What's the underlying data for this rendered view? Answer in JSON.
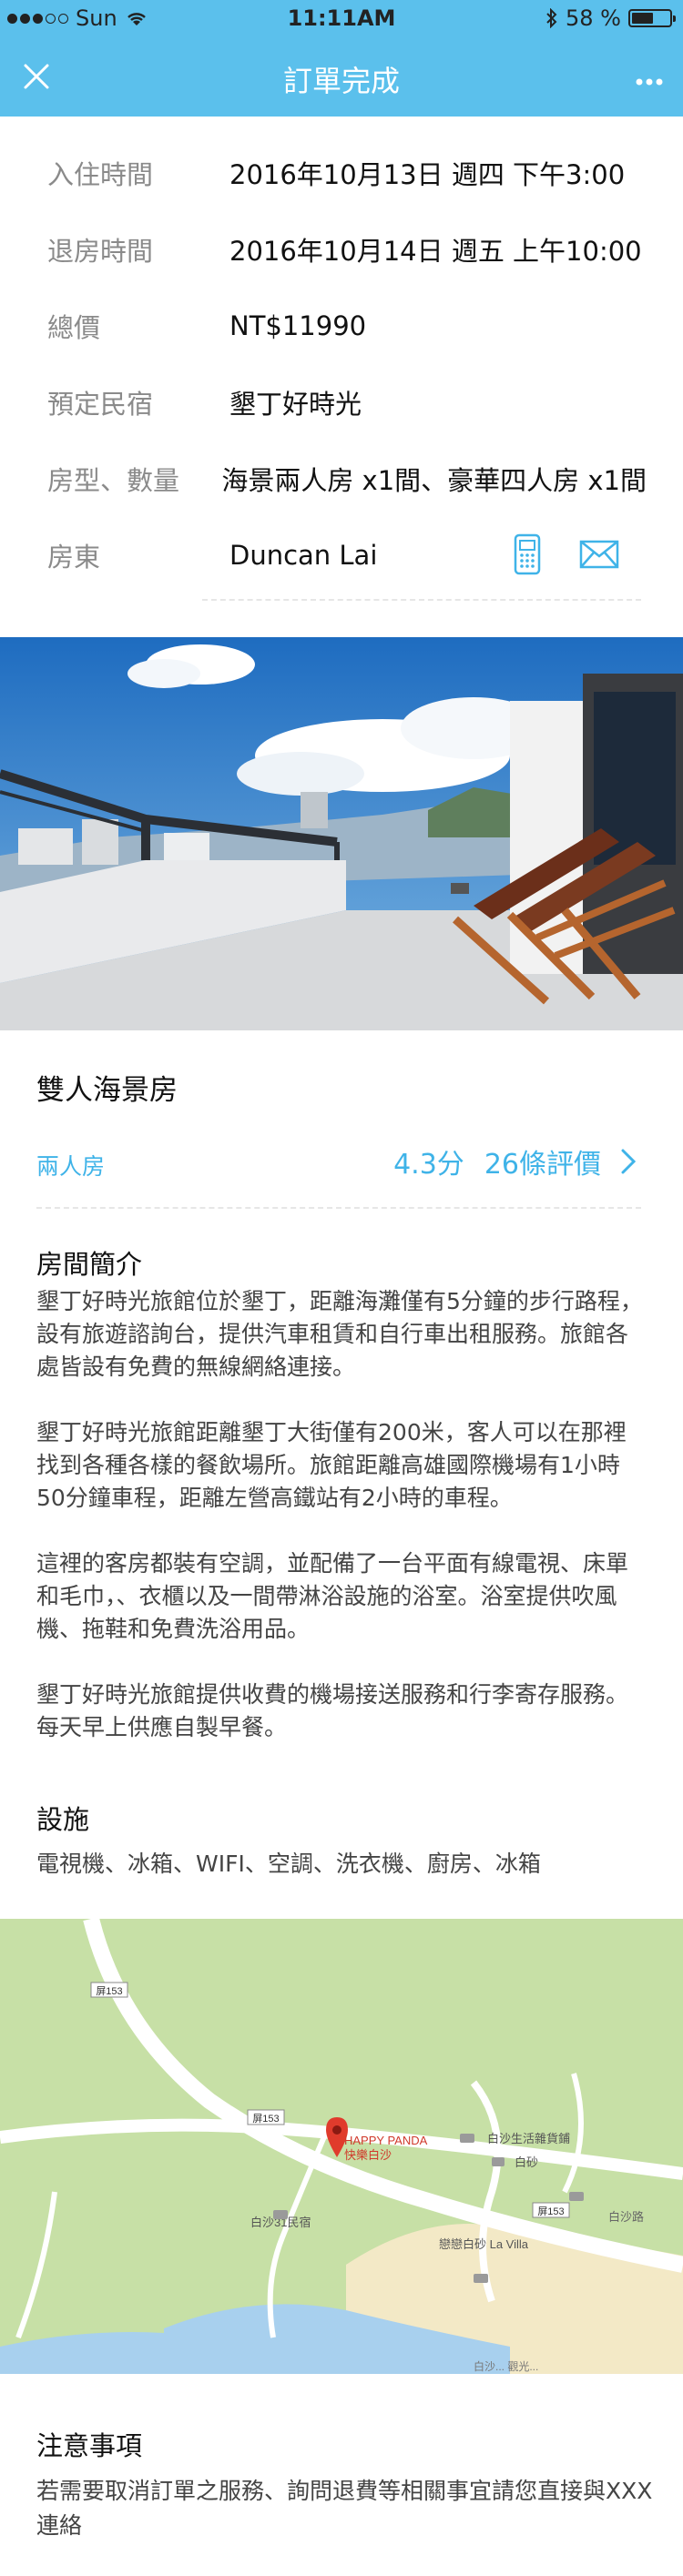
{
  "status_bar": {
    "carrier": "Sun",
    "time": "11:11AM",
    "battery": "58 %",
    "battery_level": 0.58
  },
  "nav": {
    "title": "訂單完成",
    "close_icon": "close-icon",
    "more_icon": "more-icon"
  },
  "booking": {
    "checkin_label": "入住時間",
    "checkin_value": "2016年10月13日 週四 下午3:00",
    "checkout_label": "退房時間",
    "checkout_value": "2016年10月14日 週五 上午10:00",
    "total_label": "總價",
    "total_value": "NT$11990",
    "bnb_label": "預定民宿",
    "bnb_value": "墾丁好時光",
    "room_label": "房型、數量",
    "room_value": "海景兩人房 x1間、豪華四人房 x1間",
    "host_label": "房東",
    "host_value": "Duncan Lai"
  },
  "room": {
    "title": "雙人海景房",
    "type": "兩人房",
    "score": "4.3分",
    "reviews": "26條評價"
  },
  "intro": {
    "title": "房間簡介",
    "paragraphs": [
      "墾丁好時光旅館位於墾丁，距離海灘僅有5分鐘的步行路程，設有旅遊諮詢台，提供汽車租賃和自行車出租服務。旅館各處皆設有免費的無線網絡連接。",
      "墾丁好時光旅館距離墾丁大街僅有200米，客人可以在那裡找到各種各樣的餐飲場所。旅館距離高雄國際機場有1小時50分鐘車程，距離左營高鐵站有2小時的車程。",
      "這裡的客房都裝有空調，並配備了一台平面有線電視、床單和毛巾，、衣櫃以及一間帶淋浴設施的浴室。浴室提供吹風機、拖鞋和免費洗浴用品。",
      "墾丁好時光旅館提供收費的機場接送服務和行李寄存服務。每天早上供應自製早餐。"
    ]
  },
  "facilities": {
    "title": "設施",
    "list": "電視機、冰箱、WIFI、空調、洗衣機、廚房、冰箱"
  },
  "map": {
    "road_153_a": "屏153",
    "road_153_b": "屏153",
    "road_153_c": "屏153",
    "poi_name": "HAPPY PANDA",
    "poi_sub": "快樂白沙",
    "label_baisha_life": "白沙生活雜貨鋪",
    "label_baisha": "白砂",
    "label_baisha31": "白沙31民宿",
    "label_lavilla": "戀戀白砂 La Villa",
    "label_baisha_road": "白沙路",
    "label_bottom": "白沙... 觀光..."
  },
  "notes": {
    "title": "注意事項",
    "text": "若需要取消訂單之服務、詢問退費等相關事宜請您直接與XXX連絡"
  },
  "colors": {
    "brand": "#5bc0ec",
    "accent_text": "#3fb3e8"
  }
}
